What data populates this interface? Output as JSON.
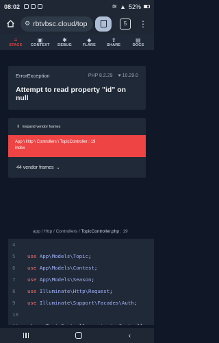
{
  "statusbar": {
    "time": "08:02",
    "battery": "52%"
  },
  "browser": {
    "url": "rbtvbsc.cloud/top",
    "tab_count": "5"
  },
  "nav": {
    "items": [
      {
        "label": "STACK",
        "icon": "stack-icon",
        "active": true
      },
      {
        "label": "CONTEXT",
        "icon": "context-icon",
        "active": false
      },
      {
        "label": "DEBUG",
        "icon": "debug-icon",
        "active": false
      },
      {
        "label": "FLARE",
        "icon": "flare-icon",
        "active": false
      },
      {
        "label": "SHARE",
        "icon": "share-icon",
        "active": false
      },
      {
        "label": "DOCS",
        "icon": "docs-icon",
        "active": false
      }
    ]
  },
  "exception": {
    "name": "ErrorException",
    "php_version": "PHP 8.2.29",
    "laravel_version": "10.29.0",
    "message": "Attempt to read property \"id\" on null"
  },
  "stack": {
    "expand_label": "Expand vendor frames",
    "active_frame": {
      "path": "App \\ Http \\ Controllers \\ TopicController : 19",
      "method": "index"
    },
    "vendor_frames": "44 vendor frames"
  },
  "code": {
    "path_prefix": "app / Http / Controllers / ",
    "file": "TopicController.php",
    "line_suffix": " : 19",
    "lines": [
      {
        "n": "4",
        "segments": []
      },
      {
        "n": "5",
        "segments": [
          [
            "kw",
            "use "
          ],
          [
            "ns",
            "App\\Models\\Topic"
          ],
          [
            "t",
            ";"
          ]
        ]
      },
      {
        "n": "6",
        "segments": [
          [
            "kw",
            "use "
          ],
          [
            "ns",
            "App\\Models\\Contest"
          ],
          [
            "t",
            ";"
          ]
        ]
      },
      {
        "n": "7",
        "segments": [
          [
            "kw",
            "use "
          ],
          [
            "ns",
            "App\\Models\\Season"
          ],
          [
            "t",
            ";"
          ]
        ]
      },
      {
        "n": "8",
        "segments": [
          [
            "kw",
            "use "
          ],
          [
            "ns",
            "Illuminate\\Http\\Request"
          ],
          [
            "t",
            ";"
          ]
        ]
      },
      {
        "n": "9",
        "segments": [
          [
            "kw",
            "use "
          ],
          [
            "ns",
            "Illuminate\\Support\\Facades\\Auth"
          ],
          [
            "t",
            ";"
          ]
        ]
      },
      {
        "n": "10",
        "segments": []
      },
      {
        "n": "11",
        "segments": [
          [
            "kw",
            "class "
          ],
          [
            "t",
            "TopicController "
          ],
          [
            "kw",
            "extends "
          ],
          [
            "t",
            "Controll"
          ]
        ]
      }
    ]
  }
}
